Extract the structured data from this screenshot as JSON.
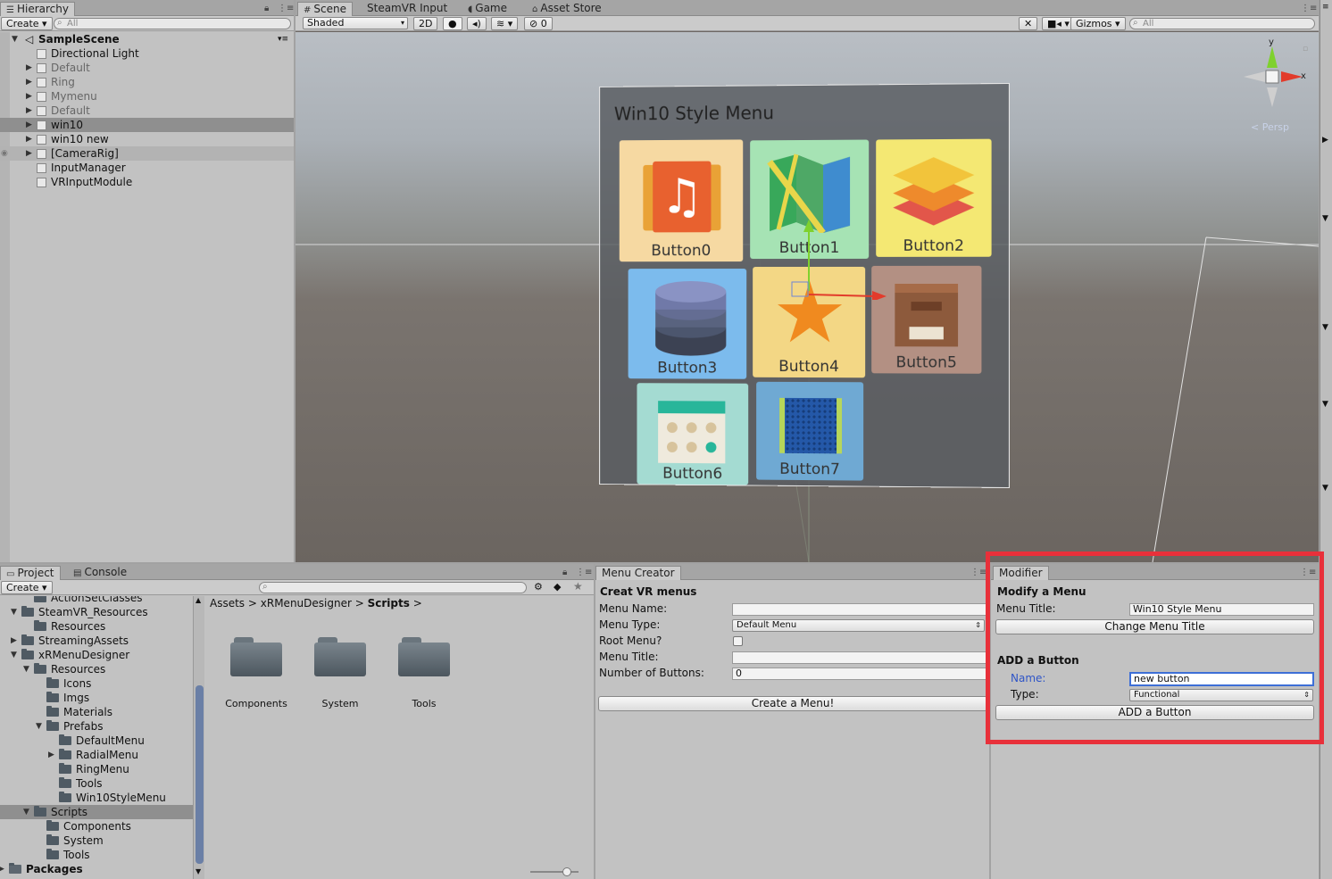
{
  "hierarchy": {
    "tab": "Hierarchy",
    "create": "Create",
    "search_placeholder": "All",
    "scene": "SampleScene",
    "items": [
      {
        "label": "Directional Light"
      },
      {
        "label": "Default"
      },
      {
        "label": "Ring"
      },
      {
        "label": "Mymenu"
      },
      {
        "label": "Default"
      },
      {
        "label": "win10"
      },
      {
        "label": "win10 new"
      },
      {
        "label": "[CameraRig]"
      },
      {
        "label": "InputManager"
      },
      {
        "label": "VRInputModule"
      }
    ]
  },
  "scene_view": {
    "tabs": [
      "Scene",
      "SteamVR Input",
      "Game",
      "Asset Store"
    ],
    "shading": "Shaded",
    "mode_2d": "2D",
    "hidden_count": "0",
    "gizmos": "Gizmos",
    "search_placeholder": "All",
    "gizmo_axes": {
      "y": "y",
      "x": "x",
      "persp": "Persp"
    },
    "menu_title": "Win10 Style Menu",
    "buttons": [
      "Button0",
      "Button1",
      "Button2",
      "Button3",
      "Button4",
      "Button5",
      "Button6",
      "Button7"
    ]
  },
  "project": {
    "tabs": [
      "Project",
      "Console"
    ],
    "create": "Create",
    "tree": [
      {
        "label": "ActionSetClasses"
      },
      {
        "label": "SteamVR_Resources"
      },
      {
        "label": "Resources"
      },
      {
        "label": "StreamingAssets"
      },
      {
        "label": "xRMenuDesigner"
      },
      {
        "label": "Resources"
      },
      {
        "label": "Icons"
      },
      {
        "label": "Imgs"
      },
      {
        "label": "Materials"
      },
      {
        "label": "Prefabs"
      },
      {
        "label": "DefaultMenu"
      },
      {
        "label": "RadialMenu"
      },
      {
        "label": "RingMenu"
      },
      {
        "label": "Tools"
      },
      {
        "label": "Win10StyleMenu"
      },
      {
        "label": "Scripts"
      },
      {
        "label": "Components"
      },
      {
        "label": "System"
      },
      {
        "label": "Tools"
      },
      {
        "label": "Packages"
      }
    ],
    "breadcrumb": [
      "Assets",
      "xRMenuDesigner",
      "Scripts"
    ],
    "folders": [
      "Components",
      "System",
      "Tools"
    ]
  },
  "menu_creator": {
    "tab": "Menu Creator",
    "heading": "Creat VR menus",
    "menu_name_label": "Menu Name:",
    "menu_name_value": "",
    "menu_type_label": "Menu Type:",
    "menu_type_value": "Default Menu",
    "root_menu_label": "Root Menu?",
    "menu_title_label": "Menu Title:",
    "menu_title_value": "",
    "num_buttons_label": "Number of Buttons:",
    "num_buttons_value": "0",
    "create_button": "Create a Menu!"
  },
  "modifier": {
    "tab": "Modifier",
    "heading": "Modify a Menu",
    "menu_title_label": "Menu Title:",
    "menu_title_value": "Win10 Style Menu",
    "change_button": "Change Menu Title",
    "add_heading": "ADD a Button",
    "name_label": "Name:",
    "name_value": "new button",
    "type_label": "Type:",
    "type_value": "Functional",
    "add_button": "ADD a Button",
    "highlight_color": "#e8303a"
  }
}
